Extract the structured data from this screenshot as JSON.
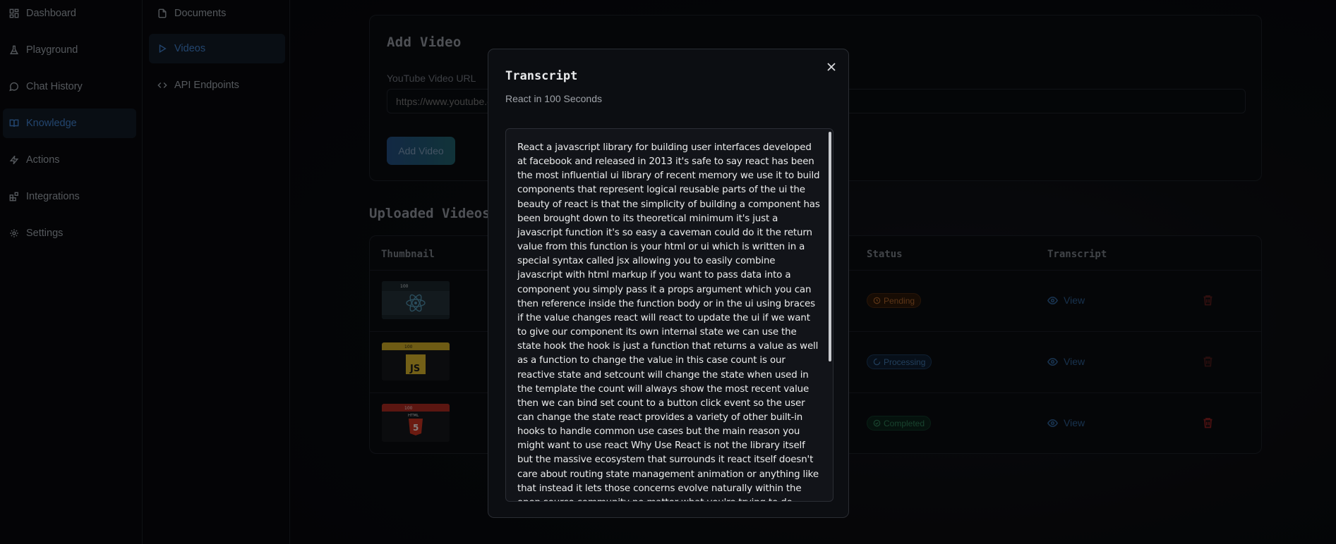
{
  "sidebar": {
    "items": [
      {
        "label": "Dashboard",
        "icon": "layout-dashboard-icon",
        "active": false
      },
      {
        "label": "Playground",
        "icon": "flask-icon",
        "active": false
      },
      {
        "label": "Chat History",
        "icon": "message-circle-icon",
        "active": false
      },
      {
        "label": "Knowledge",
        "icon": "book-open-icon",
        "active": true
      },
      {
        "label": "Actions",
        "icon": "zap-icon",
        "active": false
      },
      {
        "label": "Integrations",
        "icon": "blocks-icon",
        "active": false
      },
      {
        "label": "Settings",
        "icon": "gear-icon",
        "active": false
      }
    ]
  },
  "subnav": {
    "items": [
      {
        "label": "Documents",
        "icon": "file-icon",
        "active": false
      },
      {
        "label": "Videos",
        "icon": "play-icon",
        "active": true
      },
      {
        "label": "API Endpoints",
        "icon": "code-icon",
        "active": false
      }
    ]
  },
  "add_video": {
    "title": "Add Video",
    "url_label": "YouTube Video URL",
    "url_placeholder": "https://www.youtube.com/watch?v=...",
    "button_label": "Add Video"
  },
  "uploaded": {
    "title": "Uploaded Videos",
    "columns": {
      "thumbnail": "Thumbnail",
      "status": "Status",
      "transcript": "Transcript"
    },
    "rows": [
      {
        "thumbnail": "react-thumbnail",
        "thumb_caption": "100",
        "status": "Pending",
        "view_label": "View"
      },
      {
        "thumbnail": "javascript-thumbnail",
        "thumb_caption": "100",
        "thumb_text": "JS",
        "status": "Processing",
        "view_label": "View"
      },
      {
        "thumbnail": "html-thumbnail",
        "thumb_caption": "100",
        "thumb_text": "HTML",
        "thumb_num": "5",
        "status": "Completed",
        "view_label": "View"
      }
    ]
  },
  "modal": {
    "title": "Transcript",
    "subtitle": "React in 100 Seconds",
    "transcript": "React a javascript library for building user interfaces developed at facebook and released in 2013 it's safe to say react has been the most influential ui library of recent memory we use it to build components that represent logical reusable parts of the ui the beauty of react is that the simplicity of building a component has been brought down to its theoretical minimum it's just a javascript function it's so easy a caveman could do it the return value from this function is your html or ui which is written in a special syntax called jsx allowing you to easily combine javascript with html markup if you want to pass data into a component you simply pass it a props argument which you can then reference inside the function body or in the ui using braces if the value changes react will react to update the ui if we want to give our component its own internal state we can use the state hook the hook is just a function that returns a value as well as a function to change the value in this case count is our reactive state and setcount will change the state when used in the template the count will always show the most recent value then we can bind set count to a button click event so the user can change the state react provides a variety of other built-in hooks to handle common use cases but the main reason you might want to use react Why Use React is not the library itself but the massive ecosystem that surrounds it react itself doesn't care about routing state management animation or anything like that instead it lets those concerns evolve naturally within the open source community no matter what you're trying to do there's very likely a good supporting library to help you get it Supporting Libraries done need a static site"
  },
  "colors": {
    "accent": "#3f7ec8",
    "pending": "#a8622a",
    "processing": "#3e73a8",
    "completed": "#2d7a55",
    "danger": "#7a1f1f"
  }
}
